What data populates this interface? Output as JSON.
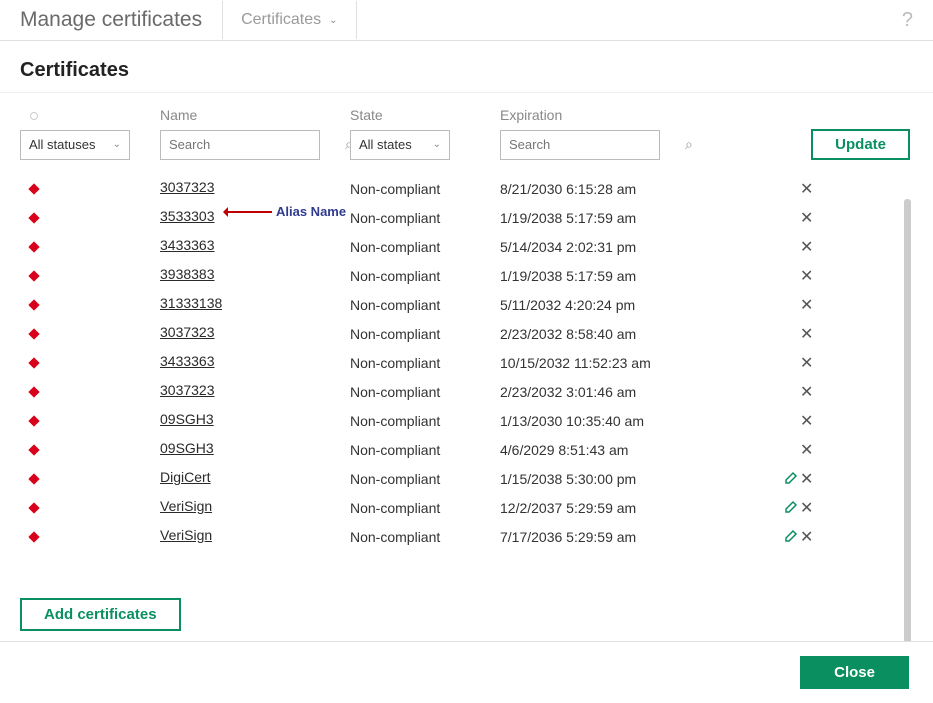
{
  "header": {
    "title": "Manage certificates",
    "dropdown_label": "Certificates",
    "help_icon": "?"
  },
  "subheader": "Certificates",
  "columns": {
    "name": "Name",
    "state": "State",
    "expiration": "Expiration"
  },
  "filters": {
    "status_label": "All statuses",
    "state_label": "All states",
    "search_placeholder": "Search"
  },
  "buttons": {
    "update": "Update",
    "add": "Add certificates",
    "close": "Close"
  },
  "annotation": {
    "label": "Alias Name"
  },
  "rows": [
    {
      "name": "3037323",
      "state": "Non-compliant",
      "expiration": "8/21/2030 6:15:28 am",
      "editable": false
    },
    {
      "name": "3533303",
      "state": "Non-compliant",
      "expiration": "1/19/2038 5:17:59 am",
      "editable": false
    },
    {
      "name": "3433363",
      "state": "Non-compliant",
      "expiration": "5/14/2034 2:02:31 pm",
      "editable": false
    },
    {
      "name": "3938383",
      "state": "Non-compliant",
      "expiration": "1/19/2038 5:17:59 am",
      "editable": false
    },
    {
      "name": "31333138",
      "state": "Non-compliant",
      "expiration": "5/11/2032 4:20:24 pm",
      "editable": false
    },
    {
      "name": "3037323",
      "state": "Non-compliant",
      "expiration": "2/23/2032 8:58:40 am",
      "editable": false
    },
    {
      "name": "3433363",
      "state": "Non-compliant",
      "expiration": "10/15/2032 11:52:23 am",
      "editable": false
    },
    {
      "name": "3037323",
      "state": "Non-compliant",
      "expiration": "2/23/2032 3:01:46 am",
      "editable": false
    },
    {
      "name": "09SGH3",
      "state": "Non-compliant",
      "expiration": "1/13/2030 10:35:40 am",
      "editable": false
    },
    {
      "name": "09SGH3",
      "state": "Non-compliant",
      "expiration": "4/6/2029 8:51:43 am",
      "editable": false
    },
    {
      "name": "DigiCert",
      "state": "Non-compliant",
      "expiration": "1/15/2038 5:30:00 pm",
      "editable": true
    },
    {
      "name": "VeriSign",
      "state": "Non-compliant",
      "expiration": "12/2/2037 5:29:59 am",
      "editable": true
    },
    {
      "name": "VeriSign",
      "state": "Non-compliant",
      "expiration": "7/17/2036 5:29:59 am",
      "editable": true
    }
  ]
}
